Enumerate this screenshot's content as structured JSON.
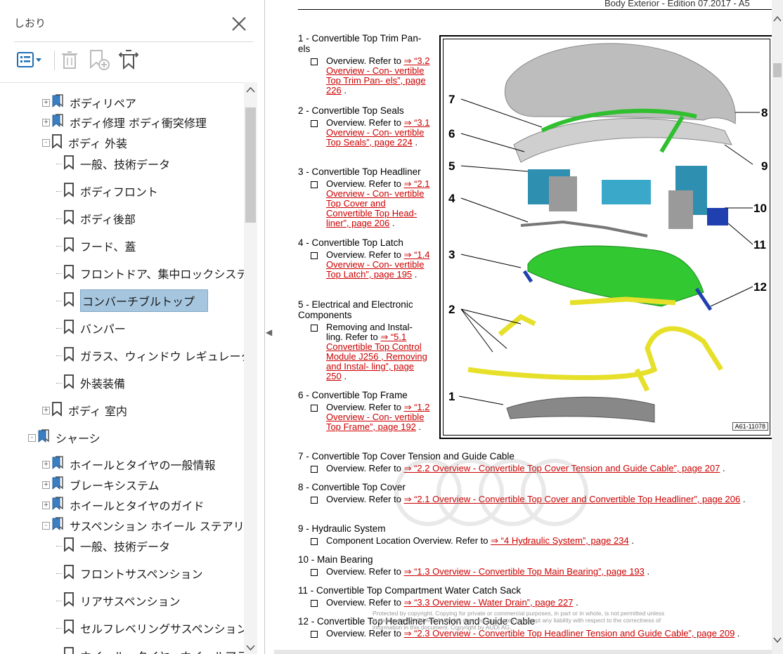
{
  "bookmarks_pane": {
    "title": "しおり",
    "tree": [
      {
        "label": "ボディリペア",
        "level": 1,
        "icon": "book-multi",
        "expander": "+"
      },
      {
        "label": "ボディ修理 ボディ衝突修理",
        "level": 1,
        "icon": "book-multi",
        "expander": "+"
      },
      {
        "label": "ボディ 外装",
        "level": 1,
        "icon": "bookmark",
        "expander": "-"
      },
      {
        "label": "一般、技術データ",
        "level": 2,
        "icon": "bookmark",
        "expander": ""
      },
      {
        "label": "ボディフロント",
        "level": 2,
        "icon": "bookmark",
        "expander": ""
      },
      {
        "label": "ボディ後部",
        "level": 2,
        "icon": "bookmark",
        "expander": ""
      },
      {
        "label": "フード、蓋",
        "level": 2,
        "icon": "bookmark",
        "expander": ""
      },
      {
        "label": "フロントドア、集中ロックシステム",
        "level": 2,
        "icon": "bookmark",
        "expander": ""
      },
      {
        "label": "コンバーチブルトップ",
        "level": 2,
        "icon": "bookmark",
        "expander": "",
        "selected": true
      },
      {
        "label": "バンパー",
        "level": 2,
        "icon": "bookmark",
        "expander": ""
      },
      {
        "label": "ガラス、ウィンドウ レギュレーター",
        "level": 2,
        "icon": "bookmark",
        "expander": ""
      },
      {
        "label": "外装装備",
        "level": 2,
        "icon": "bookmark",
        "expander": ""
      },
      {
        "label": "ボディ 室内",
        "level": 1,
        "icon": "bookmark",
        "expander": "+"
      },
      {
        "label": "シャーシ",
        "level": 0,
        "icon": "book-multi",
        "expander": "-"
      },
      {
        "label": "ホイールとタイヤの一般情報",
        "level": 1,
        "icon": "book-multi",
        "expander": "+"
      },
      {
        "label": "ブレーキシステム",
        "level": 1,
        "icon": "book-multi",
        "expander": "+"
      },
      {
        "label": "ホイールとタイヤのガイド",
        "level": 1,
        "icon": "book-multi",
        "expander": "+"
      },
      {
        "label": "サスペンション ホイール ステアリング",
        "level": 1,
        "icon": "book-multi",
        "expander": "-"
      },
      {
        "label": "一般、技術データ",
        "level": 2,
        "icon": "bookmark",
        "expander": ""
      },
      {
        "label": "フロントサスペンション",
        "level": 2,
        "icon": "bookmark",
        "expander": ""
      },
      {
        "label": "リアサスペンション",
        "level": 2,
        "icon": "bookmark",
        "expander": ""
      },
      {
        "label": "セルフレベリングサスペンション",
        "level": 2,
        "icon": "bookmark",
        "expander": ""
      },
      {
        "label": "ホイール、タイヤ、ホイールアライメ",
        "level": 2,
        "icon": "bookmark",
        "expander": ""
      }
    ],
    "colors": {
      "selected_bg": "#a6c6e0",
      "bookmark_icon": "#3a3a3a"
    }
  },
  "document": {
    "header": "Body Exterior - Edition 07.2017 - A5",
    "items": [
      {
        "title": "1 - Convertible Top Trim Pan- els",
        "text": "Overview. Refer to",
        "link": "⇒ “3.2 Overview - Con- vertible Top Trim Pan- els”, page 226"
      },
      {
        "title": "2 - Convertible Top Seals",
        "text": "Overview. Refer to",
        "link": "⇒ “3.1 Overview - Con- vertible Top Seals”, page 224"
      },
      {
        "title": "3 - Convertible Top Headliner",
        "text": "Overview. Refer to",
        "link": "⇒ “2.1 Overview - Con- vertible Top Cover and Convertible Top Head- liner”, page 206"
      },
      {
        "title": "4 - Convertible Top Latch",
        "text": "Overview. Refer to",
        "link": "⇒ “1.4 Overview - Con- vertible Top Latch”, page 195"
      },
      {
        "title": "5 - Electrical and Electronic Components",
        "text": "Removing and Instal- ling. Refer to",
        "link": "⇒ “5.1 Convertible Top Control Module J256 , Removing and Instal- ling”, page 250"
      },
      {
        "title": "6 - Convertible Top Frame",
        "text": "Overview. Refer to",
        "link": "⇒ “1.2 Overview - Con- vertible Top Frame”, page 192"
      },
      {
        "title": "7 - Convertible Top Cover Tension and Guide Cable",
        "text": "Overview. Refer to",
        "link": "⇒ “2.2 Overview - Convertible Top Cover Tension and Guide Cable”, page 207"
      },
      {
        "title": "8 - Convertible Top Cover",
        "text": "Overview. Refer to",
        "link": "⇒ “2.1 Overview - Convertible Top Cover and Convertible Top Headliner”, page 206"
      },
      {
        "title": "9 - Hydraulic System",
        "text": "Component Location Overview. Refer to",
        "link": "⇒ “4 Hydraulic System”, page 234"
      },
      {
        "title": "10 - Main Bearing",
        "text": "Overview. Refer to",
        "link": "⇒ “1.3 Overview - Convertible Top Main Bearing”, page 193"
      },
      {
        "title": "11 - Convertible Top Compartment Water Catch Sack",
        "text": "Overview. Refer to",
        "link": "⇒ “3.3 Overview - Water Drain”, page 227"
      },
      {
        "title": "12 - Convertible Top Headliner Tension and Guide Cable",
        "text": "Overview. Refer to",
        "link": "⇒ “2.3 Overview - Convertible Top Headliner Tension and Guide Cable”, page 209"
      }
    ],
    "figure": {
      "code": "A61-11078",
      "labels": [
        "1",
        "2",
        "3",
        "4",
        "5",
        "6",
        "7",
        "8",
        "9",
        "10",
        "11",
        "12"
      ]
    },
    "watermark": "Protected by copyright. Copying for private or commercial purposes, in part or in whole, is not permitted unless authorised by AUDI AG. AUDI AG does not guarantee or accept any liability with respect to the correctness of information in this document. Copyright by AUDI AG.",
    "colors": {
      "link": "#c00000",
      "top_cover": "#b9b9b9",
      "frame_green": "#3cc43c",
      "seal_yellow": "#e6e62a",
      "hydraulic_blue": "#2e8fb0"
    }
  }
}
